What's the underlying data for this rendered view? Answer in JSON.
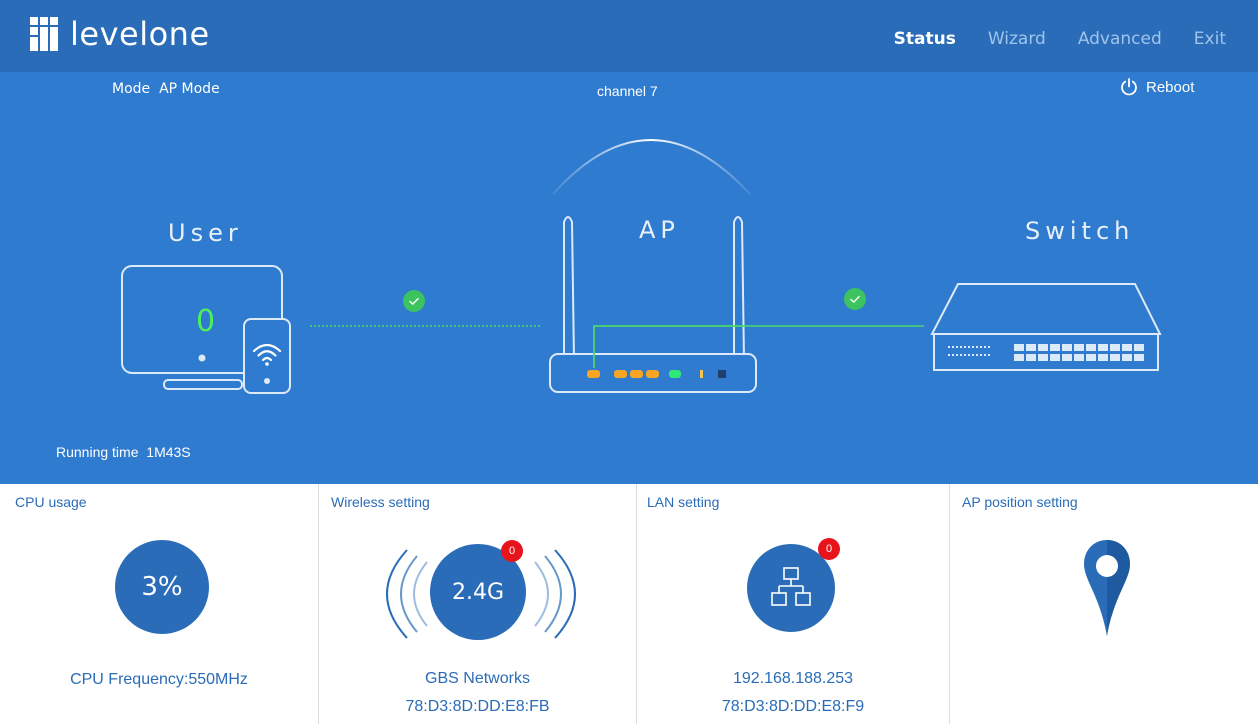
{
  "brand": {
    "name": "levelone"
  },
  "nav": {
    "status": "Status",
    "wizard": "Wizard",
    "advanced": "Advanced",
    "exit": "Exit"
  },
  "hero": {
    "mode_label": "Mode",
    "mode_value": "AP Mode",
    "channel": "channel 7",
    "reboot": "Reboot",
    "user_label": "User",
    "ap_label": "AP",
    "switch_label": "Switch",
    "user_count": "0",
    "running_label": "Running time",
    "running_value": "1M43S"
  },
  "panels": {
    "cpu": {
      "title": "CPU usage",
      "value": "3%",
      "frequency": "CPU Frequency:550MHz"
    },
    "wireless": {
      "title": "Wireless setting",
      "band": "2.4G",
      "badge": "0",
      "ssid": "GBS Networks",
      "mac": "78:D3:8D:DD:E8:FB"
    },
    "lan": {
      "title": "LAN setting",
      "badge": "0",
      "ip": "192.168.188.253",
      "mac": "78:D3:8D:DD:E8:F9"
    },
    "position": {
      "title": "AP position setting"
    }
  },
  "colors": {
    "header": "#2a6cb7",
    "hero": "#2f7bcf",
    "accent": "#2a6cb7",
    "ok": "#3cc35f",
    "count": "#4cf05a",
    "badge": "#e8141c"
  },
  "icons": {
    "reboot": "power-icon",
    "check": "check-circle-icon",
    "lan": "network-topology-icon",
    "position": "map-pin-icon"
  }
}
